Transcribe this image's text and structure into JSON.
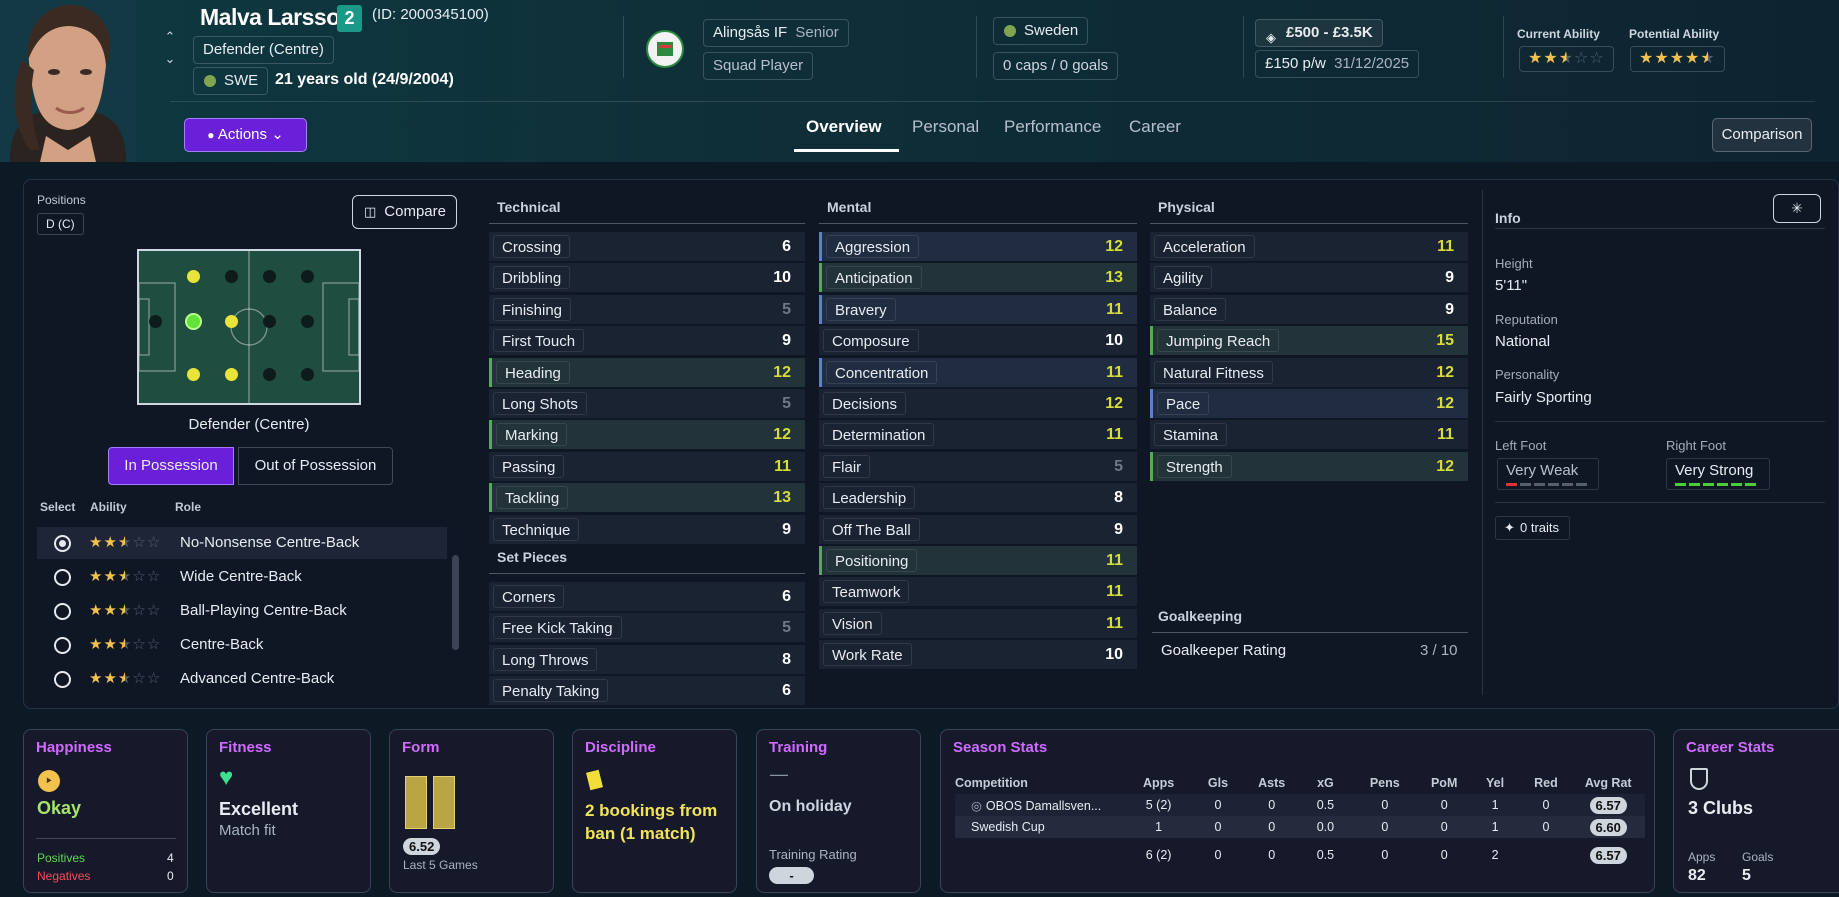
{
  "header": {
    "name": "Malva Larsson",
    "number": "2",
    "id_text": "(ID: 2000345100)",
    "position": "Defender (Centre)",
    "nationality_code": "SWE",
    "age_text": "21 years old (24/9/2004)",
    "actions_label": "Actions",
    "club": "Alingsås IF",
    "club_team": "Senior",
    "squad_status": "Squad Player",
    "country": "Sweden",
    "caps": "0 caps / 0 goals",
    "value": "£500 - £3.5K",
    "wage": "£150 p/w",
    "contract_end": "31/12/2025",
    "current_ability_label": "Current Ability",
    "potential_ability_label": "Potential Ability",
    "current_ability_stars": 2.5,
    "potential_ability_stars": 4.5,
    "tabs": [
      "Overview",
      "Personal",
      "Performance",
      "Career"
    ],
    "active_tab": "Overview",
    "comparison_label": "Comparison"
  },
  "positions": {
    "label": "Positions",
    "badge": "D (C)",
    "compare_label": "Compare",
    "pitch_caption": "Defender (Centre)",
    "possession_tabs": [
      "In Possession",
      "Out of Possession"
    ],
    "active_possession": "In Possession",
    "role_headers": [
      "Select",
      "Ability",
      "Role"
    ],
    "roles": [
      {
        "name": "No-Nonsense Centre-Back",
        "stars": 2.5,
        "selected": true
      },
      {
        "name": "Wide Centre-Back",
        "stars": 2.5,
        "selected": false
      },
      {
        "name": "Ball-Playing Centre-Back",
        "stars": 2.5,
        "selected": false
      },
      {
        "name": "Centre-Back",
        "stars": 2.5,
        "selected": false
      },
      {
        "name": "Advanced Centre-Back",
        "stars": 2.5,
        "selected": false
      }
    ]
  },
  "attributes": {
    "technical": {
      "title": "Technical",
      "items": [
        {
          "name": "Crossing",
          "value": 6,
          "hl": ""
        },
        {
          "name": "Dribbling",
          "value": 10,
          "hl": ""
        },
        {
          "name": "Finishing",
          "value": 5,
          "hl": ""
        },
        {
          "name": "First Touch",
          "value": 9,
          "hl": ""
        },
        {
          "name": "Heading",
          "value": 12,
          "hl": "green"
        },
        {
          "name": "Long Shots",
          "value": 5,
          "hl": ""
        },
        {
          "name": "Marking",
          "value": 12,
          "hl": "green"
        },
        {
          "name": "Passing",
          "value": 11,
          "hl": ""
        },
        {
          "name": "Tackling",
          "value": 13,
          "hl": "green"
        },
        {
          "name": "Technique",
          "value": 9,
          "hl": ""
        }
      ]
    },
    "set_pieces": {
      "title": "Set Pieces",
      "items": [
        {
          "name": "Corners",
          "value": 6,
          "hl": ""
        },
        {
          "name": "Free Kick Taking",
          "value": 5,
          "hl": ""
        },
        {
          "name": "Long Throws",
          "value": 8,
          "hl": ""
        },
        {
          "name": "Penalty Taking",
          "value": 6,
          "hl": ""
        }
      ]
    },
    "mental": {
      "title": "Mental",
      "items": [
        {
          "name": "Aggression",
          "value": 12,
          "hl": "blue"
        },
        {
          "name": "Anticipation",
          "value": 13,
          "hl": "green"
        },
        {
          "name": "Bravery",
          "value": 11,
          "hl": "blue"
        },
        {
          "name": "Composure",
          "value": 10,
          "hl": ""
        },
        {
          "name": "Concentration",
          "value": 11,
          "hl": "blue"
        },
        {
          "name": "Decisions",
          "value": 12,
          "hl": ""
        },
        {
          "name": "Determination",
          "value": 11,
          "hl": ""
        },
        {
          "name": "Flair",
          "value": 5,
          "hl": ""
        },
        {
          "name": "Leadership",
          "value": 8,
          "hl": ""
        },
        {
          "name": "Off The Ball",
          "value": 9,
          "hl": ""
        },
        {
          "name": "Positioning",
          "value": 11,
          "hl": "green"
        },
        {
          "name": "Teamwork",
          "value": 11,
          "hl": ""
        },
        {
          "name": "Vision",
          "value": 11,
          "hl": ""
        },
        {
          "name": "Work Rate",
          "value": 10,
          "hl": ""
        }
      ]
    },
    "physical": {
      "title": "Physical",
      "items": [
        {
          "name": "Acceleration",
          "value": 11,
          "hl": ""
        },
        {
          "name": "Agility",
          "value": 9,
          "hl": ""
        },
        {
          "name": "Balance",
          "value": 9,
          "hl": ""
        },
        {
          "name": "Jumping Reach",
          "value": 15,
          "hl": "green"
        },
        {
          "name": "Natural Fitness",
          "value": 12,
          "hl": ""
        },
        {
          "name": "Pace",
          "value": 12,
          "hl": "blue"
        },
        {
          "name": "Stamina",
          "value": 11,
          "hl": ""
        },
        {
          "name": "Strength",
          "value": 12,
          "hl": "green"
        }
      ]
    },
    "goalkeeping": {
      "title": "Goalkeeping",
      "rating_label": "Goalkeeper Rating",
      "rating_value": "3 / 10"
    }
  },
  "info": {
    "title": "Info",
    "height_label": "Height",
    "height": "5'11\"",
    "reputation_label": "Reputation",
    "reputation": "National",
    "personality_label": "Personality",
    "personality": "Fairly Sporting",
    "left_foot_label": "Left Foot",
    "left_foot": "Very Weak",
    "right_foot_label": "Right Foot",
    "right_foot": "Very Strong",
    "traits": "0 traits"
  },
  "cards": {
    "happiness": {
      "title": "Happiness",
      "status": "Okay",
      "positives_label": "Positives",
      "positives": "4",
      "negatives_label": "Negatives",
      "negatives": "0"
    },
    "fitness": {
      "title": "Fitness",
      "status": "Excellent",
      "sub": "Match fit"
    },
    "form": {
      "title": "Form",
      "rating": "6.52",
      "sub": "Last 5 Games"
    },
    "discipline": {
      "title": "Discipline",
      "text": "2 bookings from ban (1 match)"
    },
    "training": {
      "title": "Training",
      "dash": "—",
      "status": "On holiday",
      "rating_label": "Training Rating",
      "rating": "-"
    },
    "season": {
      "title": "Season Stats",
      "headers": [
        "Competition",
        "Apps",
        "Gls",
        "Asts",
        "xG",
        "Pens",
        "PoM",
        "Yel",
        "Red",
        "Avg Rat"
      ],
      "rows": [
        [
          "OBOS Damallsven...",
          "5 (2)",
          "0",
          "0",
          "0.5",
          "0",
          "0",
          "1",
          "0",
          "6.57"
        ],
        [
          "Swedish Cup",
          "1",
          "0",
          "0",
          "0.0",
          "0",
          "0",
          "1",
          "0",
          "6.60"
        ],
        [
          "",
          "6 (2)",
          "0",
          "0",
          "0.5",
          "0",
          "0",
          "2",
          "",
          "6.57"
        ]
      ]
    },
    "career": {
      "title": "Career Stats",
      "clubs": "3 Clubs",
      "apps_label": "Apps",
      "apps": "82",
      "goals_label": "Goals",
      "goals": "5"
    }
  },
  "colors": {
    "accent_purple": "#6a1fd8",
    "attr_yellow": "#d6dd3b",
    "card_title": "#cf6bff",
    "okay_green": "#a6e36a"
  }
}
